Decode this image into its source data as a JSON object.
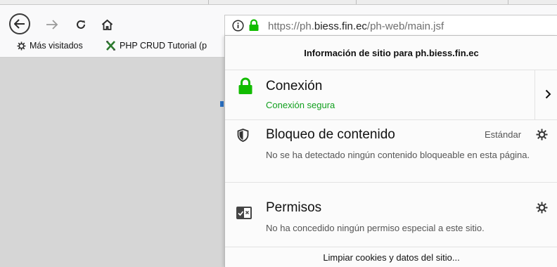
{
  "toolbar": {
    "back": "back-arrow",
    "forward": "forward-arrow",
    "reload": "reload",
    "home": "home"
  },
  "url": {
    "prefix": "https://ph.",
    "domain": "biess.fin.ec",
    "path": "/ph-web/main.jsf"
  },
  "bookmarks": [
    {
      "label": "Más visitados",
      "icon": "gear-icon"
    },
    {
      "label": "PHP CRUD Tutorial (p",
      "icon": "crud-icon"
    }
  ],
  "panel": {
    "title": "Información de sitio para ph.biess.fin.ec",
    "connection": {
      "title": "Conexión",
      "status": "Conexión segura",
      "status_color": "#12a01f"
    },
    "blocking": {
      "title": "Bloqueo de contenido",
      "mode": "Estándar",
      "desc": "No se ha detectado ningún contenido bloqueable en esta página."
    },
    "permissions": {
      "title": "Permisos",
      "desc": "No ha concedido ningún permiso especial a este sitio."
    },
    "footer": "Limpiar cookies y datos del sitio..."
  },
  "colors": {
    "lock_green": "#12bc00",
    "accent_blue": "#2a6fc0"
  }
}
